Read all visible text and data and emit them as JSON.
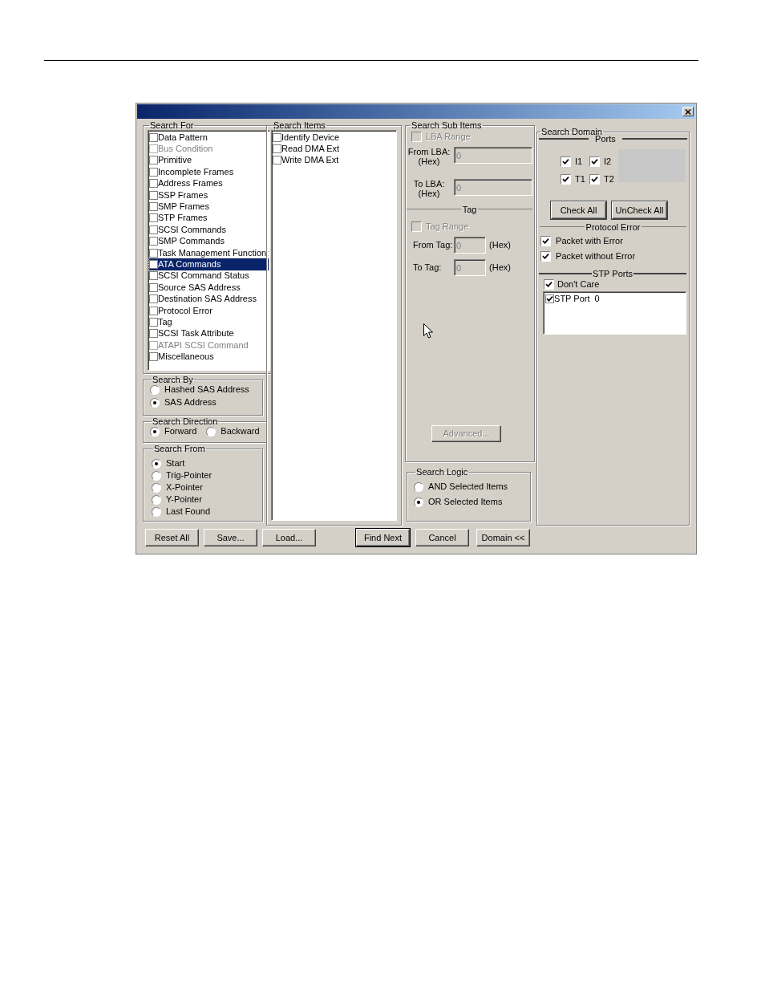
{
  "search_for": {
    "title": "Search For",
    "items": [
      {
        "label": "Data Pattern",
        "checked": false,
        "disabled": false,
        "selected": false
      },
      {
        "label": "Bus Condition",
        "checked": false,
        "disabled": true,
        "selected": false
      },
      {
        "label": "Primitive",
        "checked": false,
        "disabled": false,
        "selected": false
      },
      {
        "label": "Incomplete Frames",
        "checked": false,
        "disabled": false,
        "selected": false
      },
      {
        "label": "Address Frames",
        "checked": false,
        "disabled": false,
        "selected": false
      },
      {
        "label": "SSP Frames",
        "checked": false,
        "disabled": false,
        "selected": false
      },
      {
        "label": "SMP Frames",
        "checked": false,
        "disabled": false,
        "selected": false
      },
      {
        "label": "STP Frames",
        "checked": false,
        "disabled": false,
        "selected": false
      },
      {
        "label": "SCSI Commands",
        "checked": false,
        "disabled": false,
        "selected": false
      },
      {
        "label": "SMP Commands",
        "checked": false,
        "disabled": false,
        "selected": false
      },
      {
        "label": "Task Management Function:",
        "checked": false,
        "disabled": false,
        "selected": false
      },
      {
        "label": "ATA Commands",
        "checked": false,
        "disabled": false,
        "selected": true
      },
      {
        "label": "SCSI Command Status",
        "checked": false,
        "disabled": false,
        "selected": false
      },
      {
        "label": "Source SAS Address",
        "checked": false,
        "disabled": false,
        "selected": false
      },
      {
        "label": "Destination SAS Address",
        "checked": false,
        "disabled": false,
        "selected": false
      },
      {
        "label": "Protocol Error",
        "checked": false,
        "disabled": false,
        "selected": false
      },
      {
        "label": "Tag",
        "checked": false,
        "disabled": false,
        "selected": false
      },
      {
        "label": "SCSI Task Attribute",
        "checked": false,
        "disabled": false,
        "selected": false
      },
      {
        "label": "ATAPI SCSI Command",
        "checked": false,
        "disabled": true,
        "selected": false
      },
      {
        "label": "Miscellaneous",
        "checked": false,
        "disabled": false,
        "selected": false
      }
    ]
  },
  "search_by": {
    "title": "Search By",
    "options": [
      {
        "label": "Hashed SAS Address",
        "selected": false
      },
      {
        "label": "SAS Address",
        "selected": true
      }
    ]
  },
  "search_direction": {
    "title": "Search Direction",
    "options": [
      {
        "label": "Forward",
        "selected": true
      },
      {
        "label": "Backward",
        "selected": false
      }
    ]
  },
  "search_from": {
    "title": "Search From",
    "options": [
      {
        "label": "Start",
        "selected": true
      },
      {
        "label": "Trig-Pointer",
        "selected": false
      },
      {
        "label": "X-Pointer",
        "selected": false
      },
      {
        "label": "Y-Pointer",
        "selected": false
      },
      {
        "label": "Last Found",
        "selected": false
      }
    ]
  },
  "search_items": {
    "title": "Search Items",
    "items": [
      {
        "label": "Identify Device",
        "checked": false
      },
      {
        "label": "Read DMA Ext",
        "checked": false
      },
      {
        "label": "Write DMA Ext",
        "checked": false
      }
    ]
  },
  "search_sub_items": {
    "title": "Search Sub Items",
    "lba_range": {
      "label": "LBA Range",
      "checked": false,
      "disabled": true
    },
    "lba_fields": [
      {
        "label": "From LBA:",
        "unit": "(Hex)",
        "value": "0"
      },
      {
        "label": "To LBA:",
        "unit": "(Hex)",
        "value": "0"
      }
    ],
    "tag_heading": "Tag",
    "tag_range": {
      "label": "Tag Range",
      "checked": false,
      "disabled": true
    },
    "tag_fields": [
      {
        "label": "From Tag:",
        "unit": "(Hex)",
        "value": "0"
      },
      {
        "label": "To Tag:",
        "unit": "(Hex)",
        "value": "0"
      }
    ],
    "advanced_button": {
      "label": "Advanced...",
      "disabled": true
    }
  },
  "search_logic": {
    "title": "Search Logic",
    "options": [
      {
        "label": "AND Selected Items",
        "selected": false
      },
      {
        "label": "OR Selected Items",
        "selected": true
      }
    ]
  },
  "search_domain": {
    "title": "Search Domain",
    "ports_heading": "Ports",
    "ports": [
      {
        "label": "I1",
        "checked": true
      },
      {
        "label": "I2",
        "checked": true
      },
      {
        "label": "T1",
        "checked": true
      },
      {
        "label": "T2",
        "checked": true
      }
    ],
    "buttons": [
      "Check All",
      "UnCheck All"
    ],
    "protocol_error_heading": "Protocol Error",
    "protocol_error": [
      {
        "label": "Packet with Error",
        "checked": true
      },
      {
        "label": "Packet without Error",
        "checked": true
      }
    ],
    "stp_heading": "STP Ports",
    "dont_care": {
      "label": "Don't Care",
      "checked": true
    },
    "stp_ports": [
      {
        "label": "STP Port  0",
        "checked": true
      }
    ]
  },
  "buttons": [
    {
      "label": "Reset All",
      "default": false
    },
    {
      "label": "Save...",
      "default": false
    },
    {
      "label": "Load...",
      "default": false
    },
    {
      "label": "Find Next",
      "default": true
    },
    {
      "label": "Cancel",
      "default": false
    },
    {
      "label": "Domain <<",
      "default": false
    }
  ]
}
